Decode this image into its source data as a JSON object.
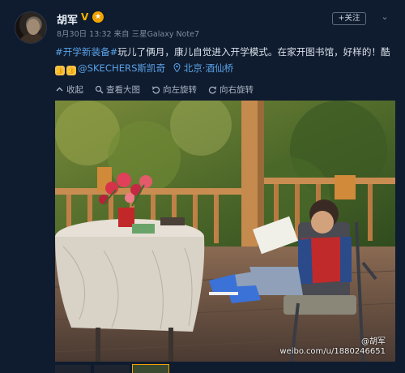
{
  "post": {
    "author": "胡军",
    "vip_badge": "V",
    "medal": "★",
    "meta": "8月30日 13:32 来自 三星Galaxy Note7",
    "follow_label": "+关注",
    "text_tag": "#开学新装备#",
    "text_body": "玩儿了俩月，康儿自觉进入开学模式。在家开图书馆，好样的！酷",
    "mention": "@SKECHERS斯凯奇",
    "location": "北京·酒仙桥"
  },
  "toolbar": {
    "collapse": "收起",
    "view_large": "查看大图",
    "rotate_left": "向左旋转",
    "rotate_right": "向右旋转"
  },
  "photo": {
    "watermark_handle": "@胡军",
    "watermark_url": "weibo.com/u/1880246651"
  },
  "colors": {
    "background": "#0f1b2e",
    "link": "#5aa3e8",
    "accent": "#ff8200"
  },
  "icons": [
    "collapse-icon",
    "magnifier-icon",
    "rotate-left-icon",
    "rotate-right-icon",
    "location-pin-icon",
    "chevron-down-icon",
    "thumbs-up-icon"
  ]
}
